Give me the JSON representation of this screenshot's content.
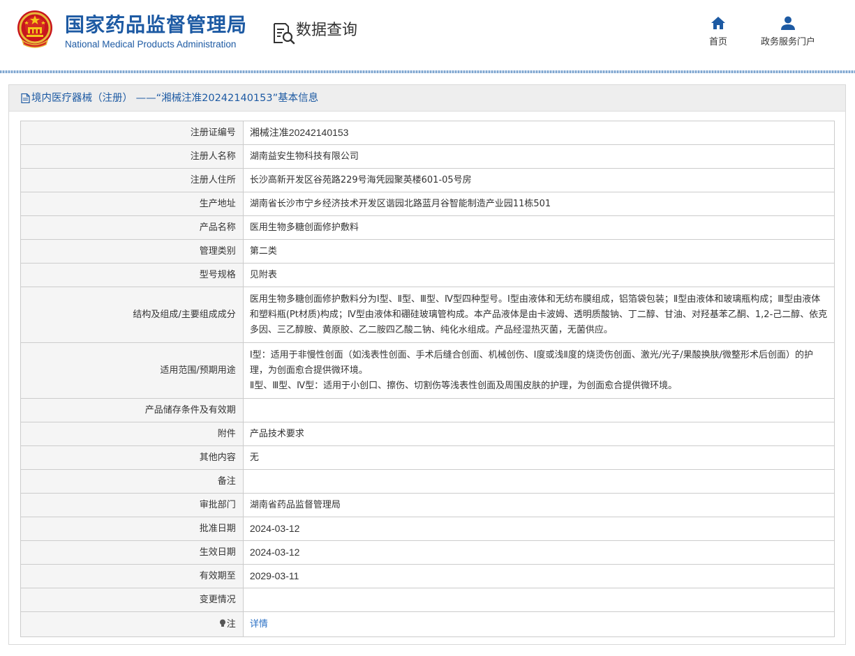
{
  "header": {
    "org_name_cn": "国家药品监督管理局",
    "org_name_en": "National Medical Products Administration",
    "data_query_label": "数据查询",
    "nav": {
      "home_label": "首页",
      "gov_service_label": "政务服务门户"
    }
  },
  "colors": {
    "brand_blue": "#1d5aa3",
    "link_blue": "#2a70c5",
    "label_bg": "#f5f5f5",
    "panel_head_bg": "#eeeeee"
  },
  "icons": {
    "emblem": "national-emblem-icon",
    "data_query": "document-search-icon",
    "home": "home-icon",
    "gov_service": "user-icon",
    "panel_title": "document-icon",
    "note": "lightbulb-icon"
  },
  "panel": {
    "title": "境内医疗器械（注册） ——“湘械注准20242140153”基本信息"
  },
  "rows": [
    {
      "label": "注册证编号",
      "value": "湘械注准20242140153"
    },
    {
      "label": "注册人名称",
      "value": "湖南益安生物科技有限公司"
    },
    {
      "label": "注册人住所",
      "value": "长沙高新开发区谷苑路229号海凭园聚英楼601-05号房"
    },
    {
      "label": "生产地址",
      "value": "湖南省长沙市宁乡经济技术开发区谐园北路蓝月谷智能制造产业园11栋501"
    },
    {
      "label": "产品名称",
      "value": "医用生物多糖创面修护敷料"
    },
    {
      "label": "管理类别",
      "value": "第二类"
    },
    {
      "label": "型号规格",
      "value": "见附表"
    },
    {
      "label": "结构及组成/主要组成成分",
      "lines": [
        "医用生物多糖创面修护敷料分为Ⅰ型、Ⅱ型、Ⅲ型、Ⅳ型四种型号。Ⅰ型由液体和无纺布膜组成，铝箔袋包装；Ⅱ型由液体和玻璃瓶构成；Ⅲ型由液体和塑料瓶(Pt材质)构成；Ⅳ型由液体和硼硅玻璃管构成。本产品液体是由卡波姆、透明质酸钠、丁二醇、甘油、对羟基苯乙酮、1,2-己二醇、依克多因、三乙醇胺、黄原胶、乙二胺四乙酸二钠、纯化水组成。产品经湿热灭菌，无菌供应。"
      ]
    },
    {
      "label": "适用范围/预期用途",
      "lines": [
        "Ⅰ型：适用于非慢性创面（如浅表性创面、手术后缝合创面、机械创伤、Ⅰ度或浅Ⅱ度的烧烫伤创面、激光/光子/果酸换肤/微整形术后创面）的护理，为创面愈合提供微环境。",
        "Ⅱ型、Ⅲ型、Ⅳ型：适用于小创口、擦伤、切割伤等浅表性创面及周围皮肤的护理，为创面愈合提供微环境。"
      ]
    },
    {
      "label": "产品储存条件及有效期",
      "value": ""
    },
    {
      "label": "附件",
      "value": "产品技术要求"
    },
    {
      "label": "其他内容",
      "value": "无"
    },
    {
      "label": "备注",
      "value": ""
    },
    {
      "label": "审批部门",
      "value": "湖南省药品监督管理局"
    },
    {
      "label": "批准日期",
      "value": "2024-03-12"
    },
    {
      "label": "生效日期",
      "value": "2024-03-12"
    },
    {
      "label": "有效期至",
      "value": "2029-03-11"
    },
    {
      "label": "变更情况",
      "value": ""
    },
    {
      "label": "注",
      "value": "详情"
    }
  ]
}
